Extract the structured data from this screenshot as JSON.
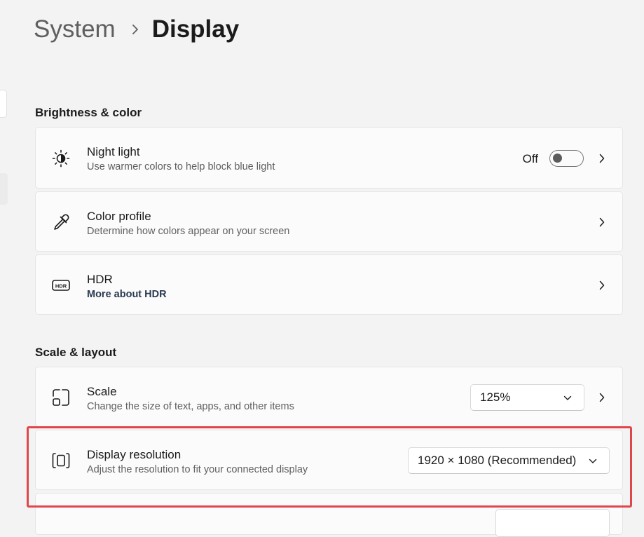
{
  "breadcrumb": {
    "parent": "System",
    "current": "Display"
  },
  "sections": {
    "brightness": {
      "title": "Brightness & color",
      "night_light": {
        "title": "Night light",
        "subtitle": "Use warmer colors to help block blue light",
        "toggle_label": "Off",
        "toggle_on": false,
        "icon": "brightness-icon"
      },
      "color_profile": {
        "title": "Color profile",
        "subtitle": "Determine how colors appear on your screen",
        "icon": "eyedropper-icon"
      },
      "hdr": {
        "title": "HDR",
        "subtitle": "More about HDR",
        "icon": "hdr-icon"
      }
    },
    "scale_layout": {
      "title": "Scale & layout",
      "scale": {
        "title": "Scale",
        "subtitle": "Change the size of text, apps, and other items",
        "value": "125%",
        "icon": "scale-icon"
      },
      "resolution": {
        "title": "Display resolution",
        "subtitle": "Adjust the resolution to fit your connected display",
        "value": "1920 × 1080 (Recommended)",
        "icon": "resolution-icon"
      }
    }
  },
  "colors": {
    "highlight": "#e0474c",
    "background": "#f3f3f3",
    "card": "#fbfbfb"
  }
}
